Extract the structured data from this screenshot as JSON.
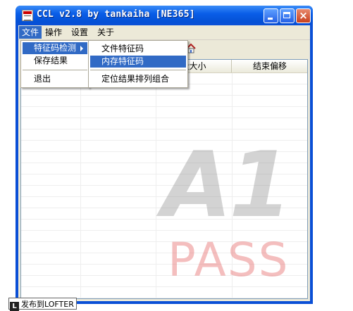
{
  "window": {
    "title": "CCL v2.8  by tankaiha [NE365]",
    "controls": {
      "minimize": "minimize",
      "maximize": "maximize",
      "close": "×"
    }
  },
  "menubar": {
    "items": [
      "文件",
      "操作",
      "设置",
      "关于"
    ]
  },
  "file_menu": {
    "items": [
      "特征码检测",
      "保存结果",
      "退出"
    ]
  },
  "submenu": {
    "items": [
      "文件特征码",
      "内存特征码",
      "定位结果排列组合"
    ]
  },
  "listview": {
    "columns": [
      "",
      "",
      "段大小",
      "结束偏移"
    ]
  },
  "watermark": {
    "main": "A1",
    "sub": "PASS"
  },
  "badge": {
    "logo": "L",
    "label": "发布到LOFTER"
  },
  "colors": {
    "accent": "#316ac5",
    "titlebar": "#0a4fd6",
    "face": "#ece9d8"
  }
}
